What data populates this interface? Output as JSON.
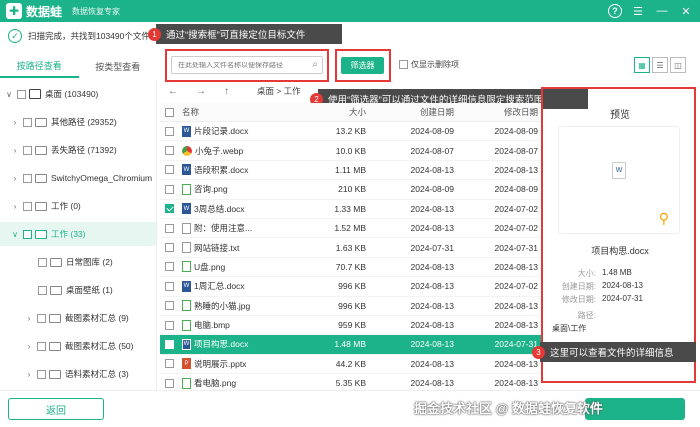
{
  "app": {
    "name": "数据蛙",
    "subtitle": "数据恢复专家"
  },
  "status": {
    "text": "扫描完成，共找到103490个文件"
  },
  "callouts": [
    {
      "num": "1",
      "text": "通过“搜索框”可直接定位目标文件"
    },
    {
      "num": "2",
      "text": "使用“筛选器”可以通过文件的详细信息限定搜索范围"
    },
    {
      "num": "3",
      "text": "这里可以查看文件的详细信息"
    }
  ],
  "tabs": [
    "按路径查看",
    "按类型查看"
  ],
  "search": {
    "placeholder": "在此处输入文件名称以便保存路径"
  },
  "filter_label": "筛选器",
  "only_deleted_label": "仅显示删除项",
  "breadcrumb": "桌面 > 工作",
  "tree": [
    {
      "label": "桌面 (103490)"
    },
    {
      "label": "其他路径 (29352)"
    },
    {
      "label": "丢失路径 (71392)"
    },
    {
      "label": "SwitchyOmega_Chromium"
    },
    {
      "label": "工作 (0)"
    },
    {
      "label": "工作 (33)"
    },
    {
      "label": "日常图库 (2)"
    },
    {
      "label": "桌面壁纸 (1)"
    },
    {
      "label": "截图素材汇总 (9)"
    },
    {
      "label": "截图素材汇总 (50)"
    },
    {
      "label": "语料素材汇总 (3)"
    }
  ],
  "table": {
    "headers": {
      "name": "名称",
      "size": "大小",
      "created": "创建日期",
      "modified": "修改日期"
    },
    "rows": [
      {
        "name": "片段记录.docx",
        "size": "13.2 KB",
        "created": "2024-08-09",
        "modified": "2024-08-09"
      },
      {
        "name": "小兔子.webp",
        "size": "10.0 KB",
        "created": "2024-08-07",
        "modified": "2024-08-07"
      },
      {
        "name": "语段积累.docx",
        "size": "1.11 MB",
        "created": "2024-08-13",
        "modified": "2024-08-13"
      },
      {
        "name": "咨询.png",
        "size": "210 KB",
        "created": "2024-08-09",
        "modified": "2024-08-09"
      },
      {
        "name": "3周总结.docx",
        "size": "1.33 MB",
        "created": "2024-08-13",
        "modified": "2024-07-02"
      },
      {
        "name": "附：使用注意...",
        "size": "1.52 MB",
        "created": "2024-08-13",
        "modified": "2024-07-02"
      },
      {
        "name": "网站链接.txt",
        "size": "1.63 KB",
        "created": "2024-07-31",
        "modified": "2024-07-31"
      },
      {
        "name": "U盘.png",
        "size": "70.7 KB",
        "created": "2024-08-13",
        "modified": "2024-08-13"
      },
      {
        "name": "1周汇总.docx",
        "size": "996 KB",
        "created": "2024-08-13",
        "modified": "2024-07-02"
      },
      {
        "name": "熟睡的小猫.jpg",
        "size": "996 KB",
        "created": "2024-08-13",
        "modified": "2024-08-13"
      },
      {
        "name": "电脑.bmp",
        "size": "959 KB",
        "created": "2024-08-13",
        "modified": "2024-08-13"
      },
      {
        "name": "项目构思.docx",
        "size": "1.48 MB",
        "created": "2024-08-13",
        "modified": "2024-07-31"
      },
      {
        "name": "说明展示.pptx",
        "size": "44.2 KB",
        "created": "2024-08-13",
        "modified": "2024-08-13"
      },
      {
        "name": "看电脑.png",
        "size": "5.35 KB",
        "created": "2024-08-13",
        "modified": "2024-08-13"
      }
    ]
  },
  "preview": {
    "title": "预览",
    "file_name": "项目构思.docx",
    "size_label": "大小:",
    "size": "1.48 MB",
    "created_label": "创建日期:",
    "created": "2024-08-13",
    "modified_label": "修改日期:",
    "modified": "2024-07-31",
    "path_label": "路径:",
    "path": "桌面\\工作"
  },
  "back_label": "返回",
  "watermark": "掘金技术社区 @ 数据蛙恢复软件",
  "colors": {
    "accent": "#1db38a",
    "callout_red": "#e53935"
  }
}
